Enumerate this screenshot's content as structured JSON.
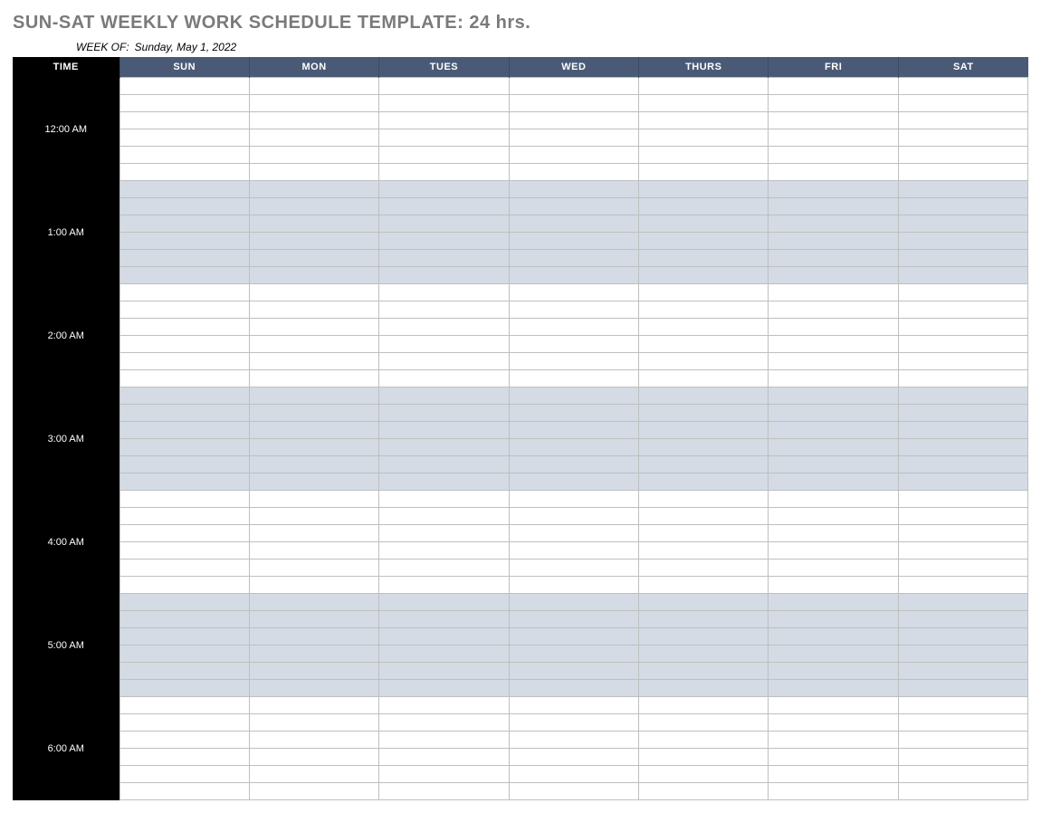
{
  "title": "SUN-SAT WEEKLY WORK SCHEDULE TEMPLATE: 24 hrs.",
  "week_of_label": "WEEK OF:",
  "week_of_date": "Sunday, May 1, 2022",
  "headers": {
    "time": "TIME",
    "days": [
      "SUN",
      "MON",
      "TUES",
      "WED",
      "THURS",
      "FRI",
      "SAT"
    ]
  },
  "hours": [
    {
      "label": "12:00 AM",
      "shade": "white"
    },
    {
      "label": "1:00 AM",
      "shade": "gray"
    },
    {
      "label": "2:00 AM",
      "shade": "white"
    },
    {
      "label": "3:00 AM",
      "shade": "gray"
    },
    {
      "label": "4:00 AM",
      "shade": "white"
    },
    {
      "label": "5:00 AM",
      "shade": "gray"
    },
    {
      "label": "6:00 AM",
      "shade": "white"
    }
  ],
  "subrows_per_hour": 6,
  "day_count": 7
}
